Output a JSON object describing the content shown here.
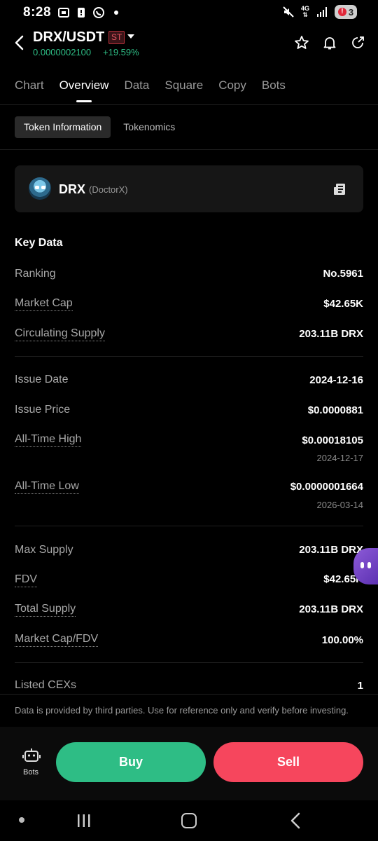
{
  "status_bar": {
    "time": "8:28",
    "network": "4G",
    "battery_alert": "!",
    "battery_level": "3"
  },
  "header": {
    "pair": "DRX/USDT",
    "badge": "ST",
    "price": "0.0000002100",
    "change": "+19.59%",
    "icons": [
      "back-icon",
      "star-icon",
      "bell-icon",
      "share-icon"
    ]
  },
  "tabs": [
    "Chart",
    "Overview",
    "Data",
    "Square",
    "Copy",
    "Bots"
  ],
  "active_tab": "Overview",
  "subtabs": [
    "Token Information",
    "Tokenomics"
  ],
  "active_subtab": "Token Information",
  "token": {
    "symbol": "DRX",
    "name": "(DoctorX)"
  },
  "key_data": {
    "title": "Key Data",
    "ranking": {
      "label": "Ranking",
      "value": "No.5961"
    },
    "market_cap": {
      "label": "Market Cap",
      "value": "$42.65K"
    },
    "circulating_supply": {
      "label": "Circulating Supply",
      "value": "203.11B DRX"
    },
    "issue_date": {
      "label": "Issue Date",
      "value": "2024-12-16"
    },
    "issue_price": {
      "label": "Issue Price",
      "value": "$0.0000881"
    },
    "ath": {
      "label": "All-Time High",
      "value": "$0.00018105",
      "date": "2024-12-17"
    },
    "atl": {
      "label": "All-Time Low",
      "value": "$0.0000001664",
      "date": "2026-03-14"
    },
    "max_supply": {
      "label": "Max Supply",
      "value": "203.11B DRX"
    },
    "fdv": {
      "label": "FDV",
      "value": "$42.65K"
    },
    "total_supply": {
      "label": "Total Supply",
      "value": "203.11B DRX"
    },
    "mcap_fdv": {
      "label": "Market Cap/FDV",
      "value": "100.00%"
    },
    "listed_cexs": {
      "label": "Listed CEXs",
      "value": "1"
    }
  },
  "disclaimer": "Data is provided by third parties. Use for reference only and verify before investing.",
  "bottom": {
    "bots_label": "Bots",
    "buy_label": "Buy",
    "sell_label": "Sell"
  },
  "colors": {
    "up": "#2ebd85",
    "down": "#f6465d",
    "background": "#000000",
    "card": "#161616"
  }
}
